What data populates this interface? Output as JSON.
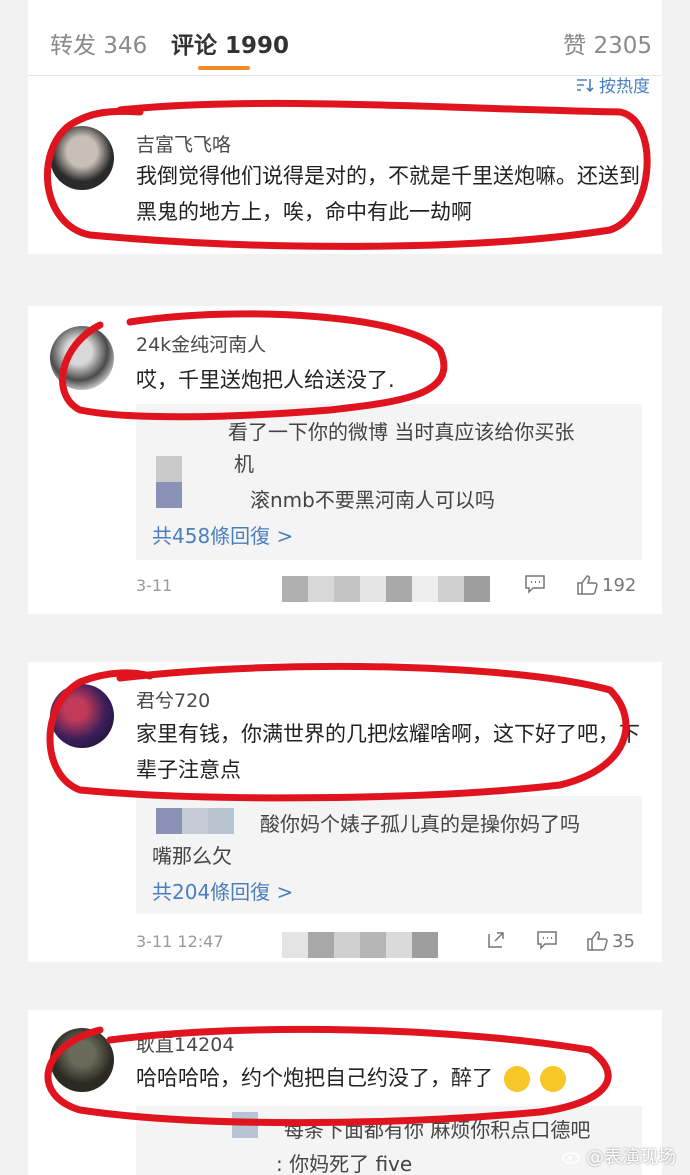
{
  "tabs": {
    "repost_label": "转发 346",
    "comments_label": "评论 1990",
    "likes_label": "赞 2305"
  },
  "sort": {
    "label": "按热度",
    "icon": "sort-icon"
  },
  "comments": [
    {
      "username": "吉富飞飞咯",
      "text": "我倒觉得他们说得是对的，不就是千里送炮嘛。还送到黑鬼的地方上，唉，命中有此一劫啊"
    },
    {
      "username": "24k金纯河南人",
      "text": "哎，千里送炮把人给送没了.",
      "replies": [
        "看了一下你的微博  当时真应该给你买张",
        "机",
        "滚nmb不要黑河南人可以吗"
      ],
      "more_replies": "共458條回復 >",
      "date": "3-11",
      "likes": "192"
    },
    {
      "username": "君兮720",
      "text": "家里有钱，你满世界的几把炫耀啥啊，这下好了吧，下辈子注意点",
      "replies": [
        "酸你妈个婊子孤儿真的是操你妈了吗",
        "嘴那么欠"
      ],
      "more_replies": "共204條回復 >",
      "date": "3-11 12:47",
      "likes": "35"
    },
    {
      "username": "耿直14204",
      "text": "哈哈哈哈，约个炮把自己约没了，醉了",
      "replies": [
        "每条下面都有你 麻烦你积点口德吧",
        ": 你妈死了 five"
      ]
    }
  ],
  "watermark": "@表演现场",
  "colors": {
    "accent": "#f08a24",
    "link": "#4a7fbf",
    "marker": "#e0141e"
  }
}
